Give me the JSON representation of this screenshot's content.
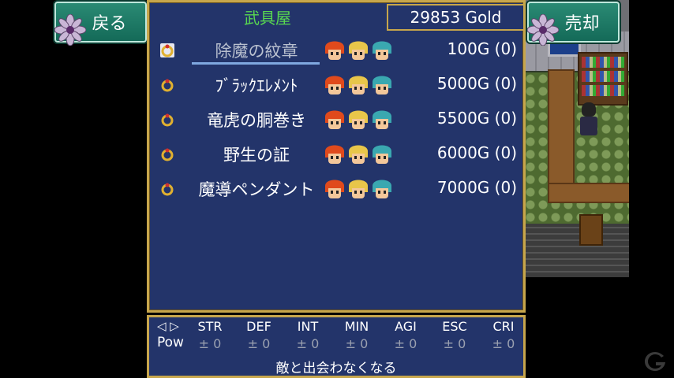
{
  "buttons": {
    "back_label": "戻る",
    "sell_label": "売却"
  },
  "shop": {
    "title": "武具屋",
    "gold": "29853 Gold",
    "items": [
      {
        "name": "除魔の紋章",
        "price": "100G (0)",
        "selected": true
      },
      {
        "name": "ﾌﾞﾗｯｸｴﾚﾒﾝﾄ",
        "price": "5000G (0)",
        "selected": false
      },
      {
        "name": "竜虎の胴巻き",
        "price": "5500G (0)",
        "selected": false
      },
      {
        "name": "野生の証",
        "price": "6000G (0)",
        "selected": false
      },
      {
        "name": "魔導ペンダント",
        "price": "7000G (0)",
        "selected": false
      }
    ]
  },
  "stats": {
    "arrows": "◁ ▷",
    "pow_label": "Pow",
    "items": [
      {
        "name": "STR",
        "value": "± 0"
      },
      {
        "name": "DEF",
        "value": "± 0"
      },
      {
        "name": "INT",
        "value": "± 0"
      },
      {
        "name": "MIN",
        "value": "± 0"
      },
      {
        "name": "AGI",
        "value": "± 0"
      },
      {
        "name": "ESC",
        "value": "± 0"
      },
      {
        "name": "CRI",
        "value": "± 0"
      }
    ],
    "description": "敵と出会わなくなる"
  },
  "colors": {
    "window_bg": "#23346a",
    "border_gold": "#c7a64c",
    "title_green": "#58d850",
    "button_teal": "#1f7a66"
  },
  "icons": [
    "flower-emblem-icon",
    "ring-accessory-icon",
    "party-face-icon",
    "gamer-logo-icon"
  ]
}
